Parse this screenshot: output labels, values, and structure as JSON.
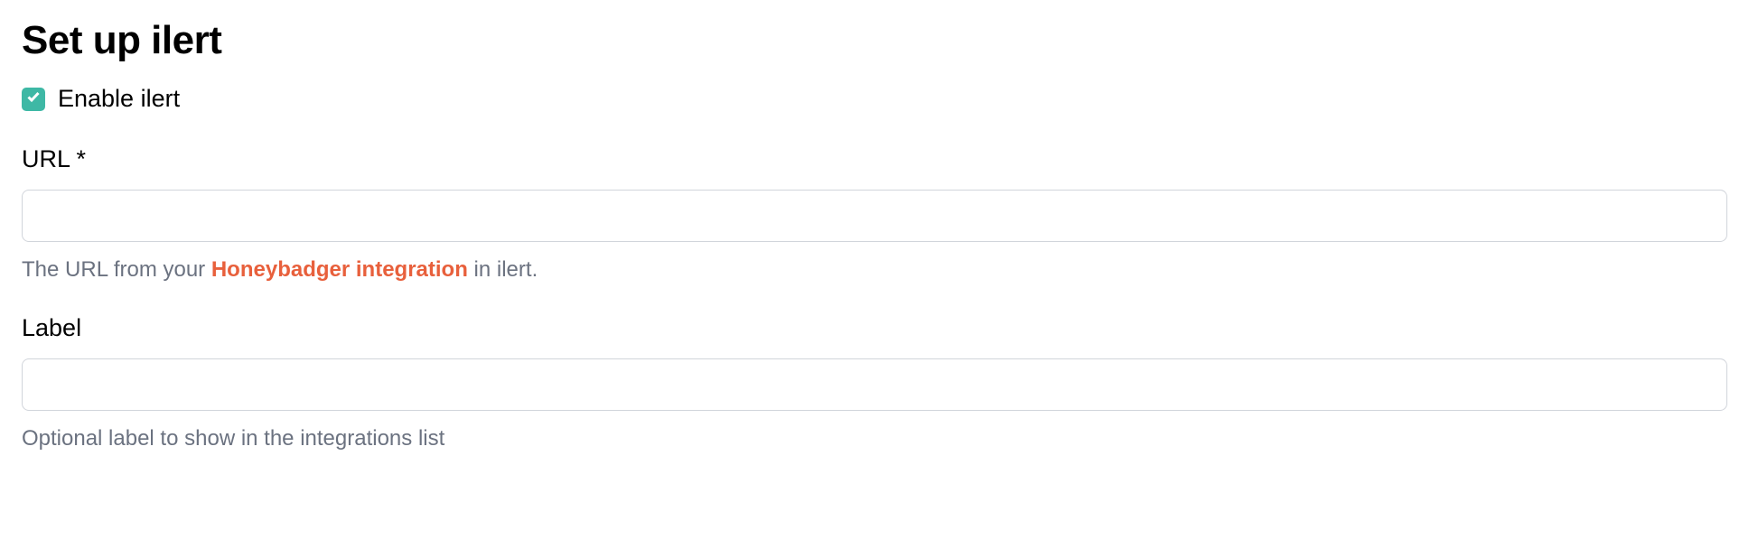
{
  "header": {
    "title": "Set up ilert"
  },
  "enable": {
    "label": "Enable ilert",
    "checked": true
  },
  "fields": {
    "url": {
      "label": "URL *",
      "value": "",
      "help_prefix": "The URL from your ",
      "help_link_text": "Honeybadger integration",
      "help_suffix": " in ilert."
    },
    "label": {
      "label": "Label",
      "value": "",
      "help": "Optional label to show in the integrations list"
    }
  }
}
